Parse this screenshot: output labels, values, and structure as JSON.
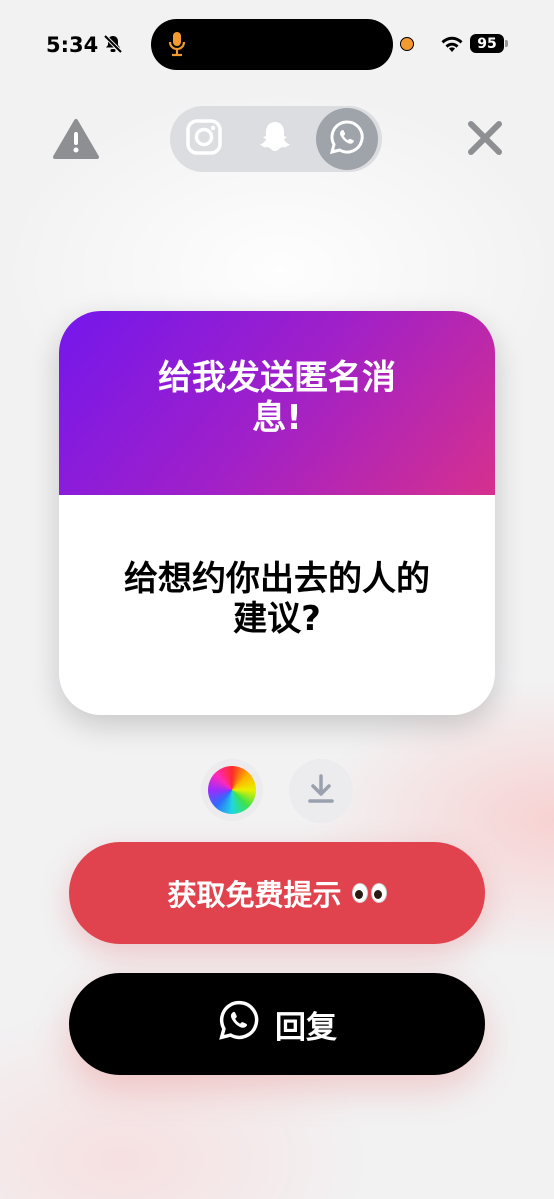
{
  "status_bar": {
    "time": "5:34",
    "battery": "95"
  },
  "platforms": [
    {
      "name": "instagram",
      "icon": "instagram-icon",
      "active": false
    },
    {
      "name": "snapchat",
      "icon": "snapchat-icon",
      "active": false
    },
    {
      "name": "whatsapp",
      "icon": "whatsapp-icon",
      "active": true
    }
  ],
  "card": {
    "title": "给我发送匿名消息!",
    "question": "给想约你出去的人的建议?"
  },
  "buttons": {
    "hint_label": "获取免费提示",
    "reply_label": "回复"
  },
  "colors": {
    "hint_button": "#e0434d",
    "reply_button": "#000000",
    "card_gradient_start": "#7417ec",
    "card_gradient_end": "#d6308e"
  }
}
